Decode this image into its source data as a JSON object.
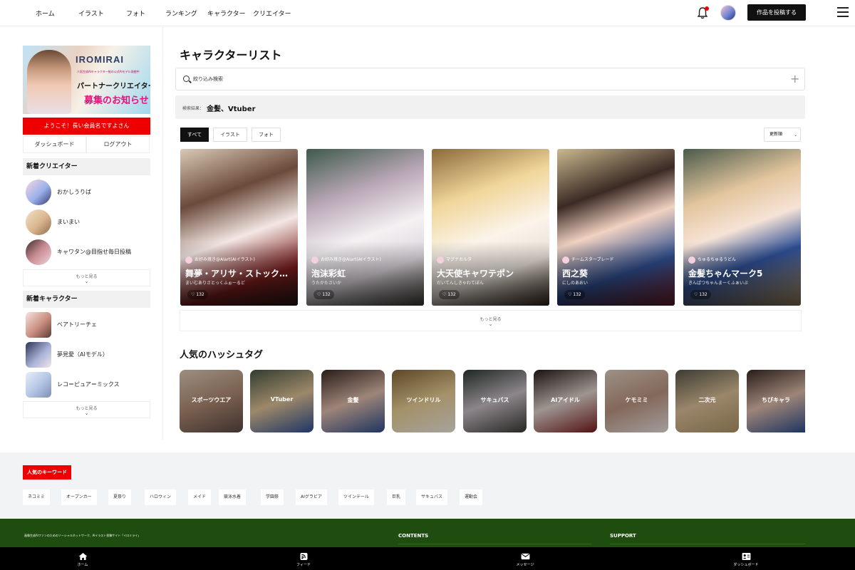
{
  "nav": {
    "items": [
      "ホーム",
      "イラスト",
      "フォト",
      "ランキング",
      "キャラクター",
      "クリエイター"
    ],
    "post_button": "作品を投稿する"
  },
  "sidebar": {
    "banner": {
      "logo": "IROMIRAI",
      "subtitle": "人気生成AIキャラクター絵の公式AIモデル発掘中",
      "line1": "パートナークリエイター",
      "line2": "募集のお知らせ"
    },
    "welcome": "ようこそ！長い会員名ですよさん",
    "dashboard_label": "ダッシュボード",
    "logout_label": "ログアウト",
    "new_creators_title": "新着クリエイター",
    "new_creators": [
      "おかしうりば",
      "まいまい",
      "キャワタン@目指せ毎日投稿"
    ],
    "new_characters_title": "新着キャラクター",
    "new_characters": [
      "ベアトリーチェ",
      "夢見愛（AIモデル）",
      "レコ＝ピュア＝ミックス"
    ],
    "more_label": "もっと見る"
  },
  "main": {
    "title": "キャラクターリスト",
    "search_placeholder": "絞り込み検索",
    "result_label": "検索結果：",
    "result_value": "金髪、Vtuber",
    "filters": [
      "すべて",
      "イラスト",
      "フォト"
    ],
    "sort_label": "更新順",
    "cards": [
      {
        "creator": "お好み焼き@AIart(AIイラスト)",
        "title": "舞夢・アリサ・ストックホルム",
        "reading": "まいむありさとっくふぉーるど",
        "likes": "132"
      },
      {
        "creator": "お好み焼き@AIart(AIイラスト)",
        "title": "泡沫彩虹",
        "reading": "うたかたさいか",
        "likes": "132"
      },
      {
        "creator": "マグナカルタ",
        "title": "大天使キャワテポン",
        "reading": "だいてんしきゃわてぽん",
        "likes": "132"
      },
      {
        "creator": "チームスターブレード",
        "title": "西之葵",
        "reading": "にしのあおい",
        "likes": "132"
      },
      {
        "creator": "ちゅるちゅるうどん",
        "title": "金髪ちゃんマーク5",
        "reading": "きんぱつちゃんまーくふぁいぶ",
        "likes": "132"
      }
    ],
    "more_label": "もっと見る",
    "hashtag_title": "人気のハッシュタグ",
    "hashtags": [
      "スポーツウエア",
      "VTuber",
      "金髪",
      "ツインドリル",
      "サキュバス",
      "AIアイドル",
      "ケモミミ",
      "二次元",
      "ちびキャラ"
    ]
  },
  "keywords": {
    "title": "人気のキーワード",
    "items": [
      "ネコミミ",
      "オープンカー",
      "夏祭り",
      "ハロウィン",
      "メイド",
      "競泳水着",
      "学園祭",
      "AIグラビア",
      "ツインテール",
      "巨乳",
      "サキュバス",
      "運動会"
    ]
  },
  "footer": {
    "description": "画像生成AIファンのためのソーシャルネットワーク、AIイラスト投稿サイト「イロミライ」",
    "contents_label": "CONTENTS",
    "support_label": "SUPPORT"
  },
  "bottom_nav": [
    "ホーム",
    "フィード",
    "メッセージ",
    "ダッシュボード"
  ],
  "colors": {
    "accent": "#ee0000",
    "footer": "#1e4d0f",
    "bottom_bar": "#000000"
  }
}
